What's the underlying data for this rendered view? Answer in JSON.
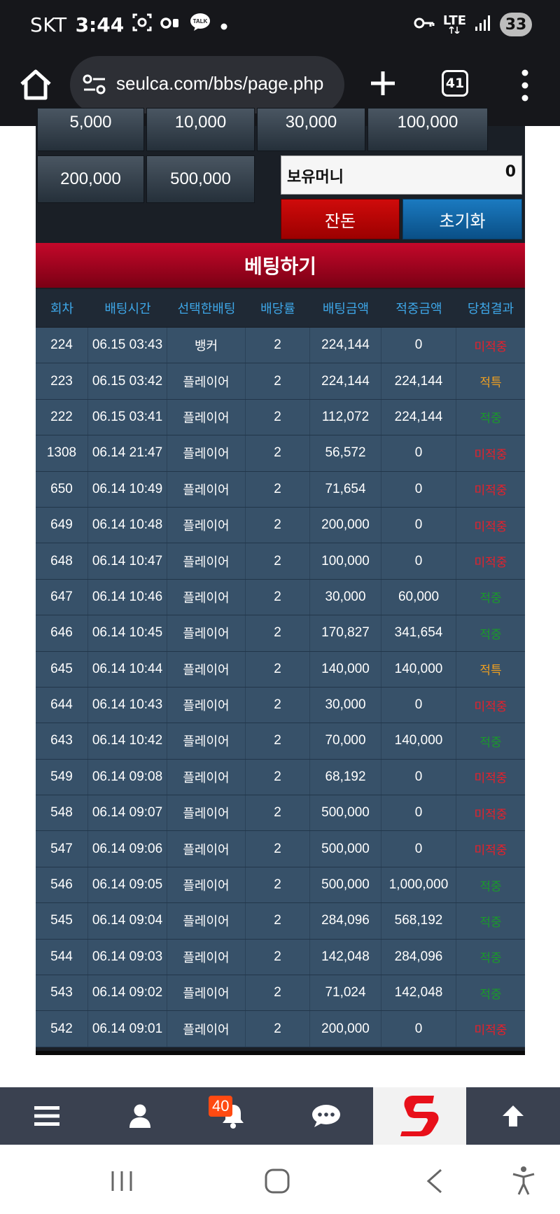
{
  "status_bar": {
    "carrier": "SKT",
    "time": "3:44",
    "talk_badge": "TALK",
    "network": "LTE",
    "battery": "33"
  },
  "browser": {
    "url": "seulca.com/bbs/page.php",
    "tab_count": "41"
  },
  "chips": {
    "top_row": [
      "5,000",
      "10,000",
      "30,000",
      "100,000"
    ],
    "row2": [
      "200,000",
      "500,000"
    ]
  },
  "money": {
    "label": "보유머니",
    "value": "0"
  },
  "buttons": {
    "balance": "잔돈",
    "reset": "초기화"
  },
  "bet_title": "베팅하기",
  "table": {
    "headers": [
      "회차",
      "배팅시간",
      "선택한배팅",
      "배당률",
      "배팅금액",
      "적중금액",
      "당첨결과"
    ],
    "rows": [
      [
        "224",
        "06.15 03:43",
        "뱅커",
        "2",
        "224,144",
        "0",
        "미적중"
      ],
      [
        "223",
        "06.15 03:42",
        "플레이어",
        "2",
        "224,144",
        "224,144",
        "적특"
      ],
      [
        "222",
        "06.15 03:41",
        "플레이어",
        "2",
        "112,072",
        "224,144",
        "적중"
      ],
      [
        "1308",
        "06.14 21:47",
        "플레이어",
        "2",
        "56,572",
        "0",
        "미적중"
      ],
      [
        "650",
        "06.14 10:49",
        "플레이어",
        "2",
        "71,654",
        "0",
        "미적중"
      ],
      [
        "649",
        "06.14 10:48",
        "플레이어",
        "2",
        "200,000",
        "0",
        "미적중"
      ],
      [
        "648",
        "06.14 10:47",
        "플레이어",
        "2",
        "100,000",
        "0",
        "미적중"
      ],
      [
        "647",
        "06.14 10:46",
        "플레이어",
        "2",
        "30,000",
        "60,000",
        "적중"
      ],
      [
        "646",
        "06.14 10:45",
        "플레이어",
        "2",
        "170,827",
        "341,654",
        "적중"
      ],
      [
        "645",
        "06.14 10:44",
        "플레이어",
        "2",
        "140,000",
        "140,000",
        "적특"
      ],
      [
        "644",
        "06.14 10:43",
        "플레이어",
        "2",
        "30,000",
        "0",
        "미적중"
      ],
      [
        "643",
        "06.14 10:42",
        "플레이어",
        "2",
        "70,000",
        "140,000",
        "적중"
      ],
      [
        "549",
        "06.14 09:08",
        "플레이어",
        "2",
        "68,192",
        "0",
        "미적중"
      ],
      [
        "548",
        "06.14 09:07",
        "플레이어",
        "2",
        "500,000",
        "0",
        "미적중"
      ],
      [
        "547",
        "06.14 09:06",
        "플레이어",
        "2",
        "500,000",
        "0",
        "미적중"
      ],
      [
        "546",
        "06.14 09:05",
        "플레이어",
        "2",
        "500,000",
        "1,000,000",
        "적중"
      ],
      [
        "545",
        "06.14 09:04",
        "플레이어",
        "2",
        "284,096",
        "568,192",
        "적중"
      ],
      [
        "544",
        "06.14 09:03",
        "플레이어",
        "2",
        "142,048",
        "284,096",
        "적중"
      ],
      [
        "543",
        "06.14 09:02",
        "플레이어",
        "2",
        "71,024",
        "142,048",
        "적중"
      ],
      [
        "542",
        "06.14 09:01",
        "플레이어",
        "2",
        "200,000",
        "0",
        "미적중"
      ]
    ]
  },
  "result_colors": {
    "미적중": "#e8202a",
    "적특": "#f0a020",
    "적중": "#1a9a2a"
  },
  "bottom_nav": {
    "notification_count": "40",
    "icons": [
      "menu-icon",
      "user-icon",
      "bell-icon",
      "chat-icon",
      "site-logo",
      "arrow-up-icon"
    ]
  }
}
